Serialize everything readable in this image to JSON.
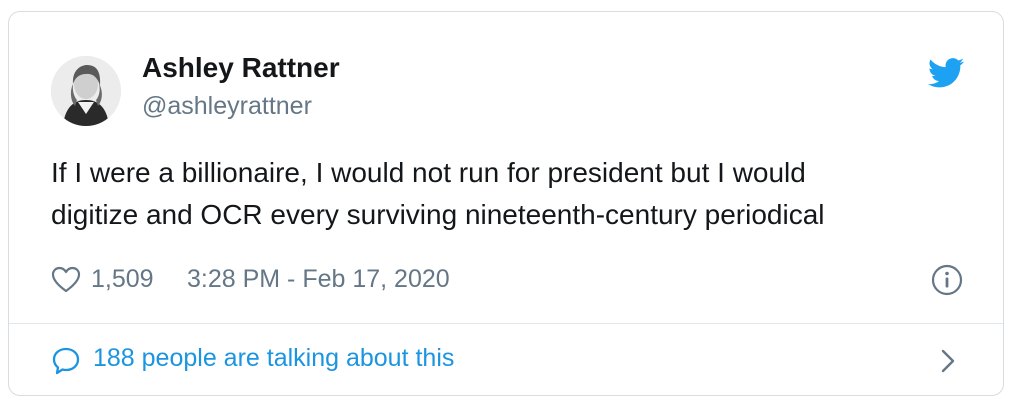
{
  "author": {
    "display_name": "Ashley Rattner",
    "handle": "@ashleyrattner",
    "avatar_icon": "profile-photo",
    "brand_icon": "twitter-bird-icon"
  },
  "tweet": {
    "lines": [
      "If I were a billionaire, I would not run for president but I would",
      "digitize and OCR every surviving nineteenth-century periodical"
    ]
  },
  "meta": {
    "like_icon": "heart-icon",
    "like_count": "1,509",
    "timestamp": "3:28 PM - Feb 17, 2020",
    "info_icon": "info-icon"
  },
  "footer": {
    "icon": "speech-bubble-icon",
    "talking_text": "188 people are talking about this",
    "chevron_icon": "chevron-right-icon"
  },
  "colors": {
    "text": "#14171a",
    "secondary": "#657786",
    "accent": "#1b95e0",
    "twitter_blue": "#1da1f2",
    "border": "#d6dde3"
  }
}
